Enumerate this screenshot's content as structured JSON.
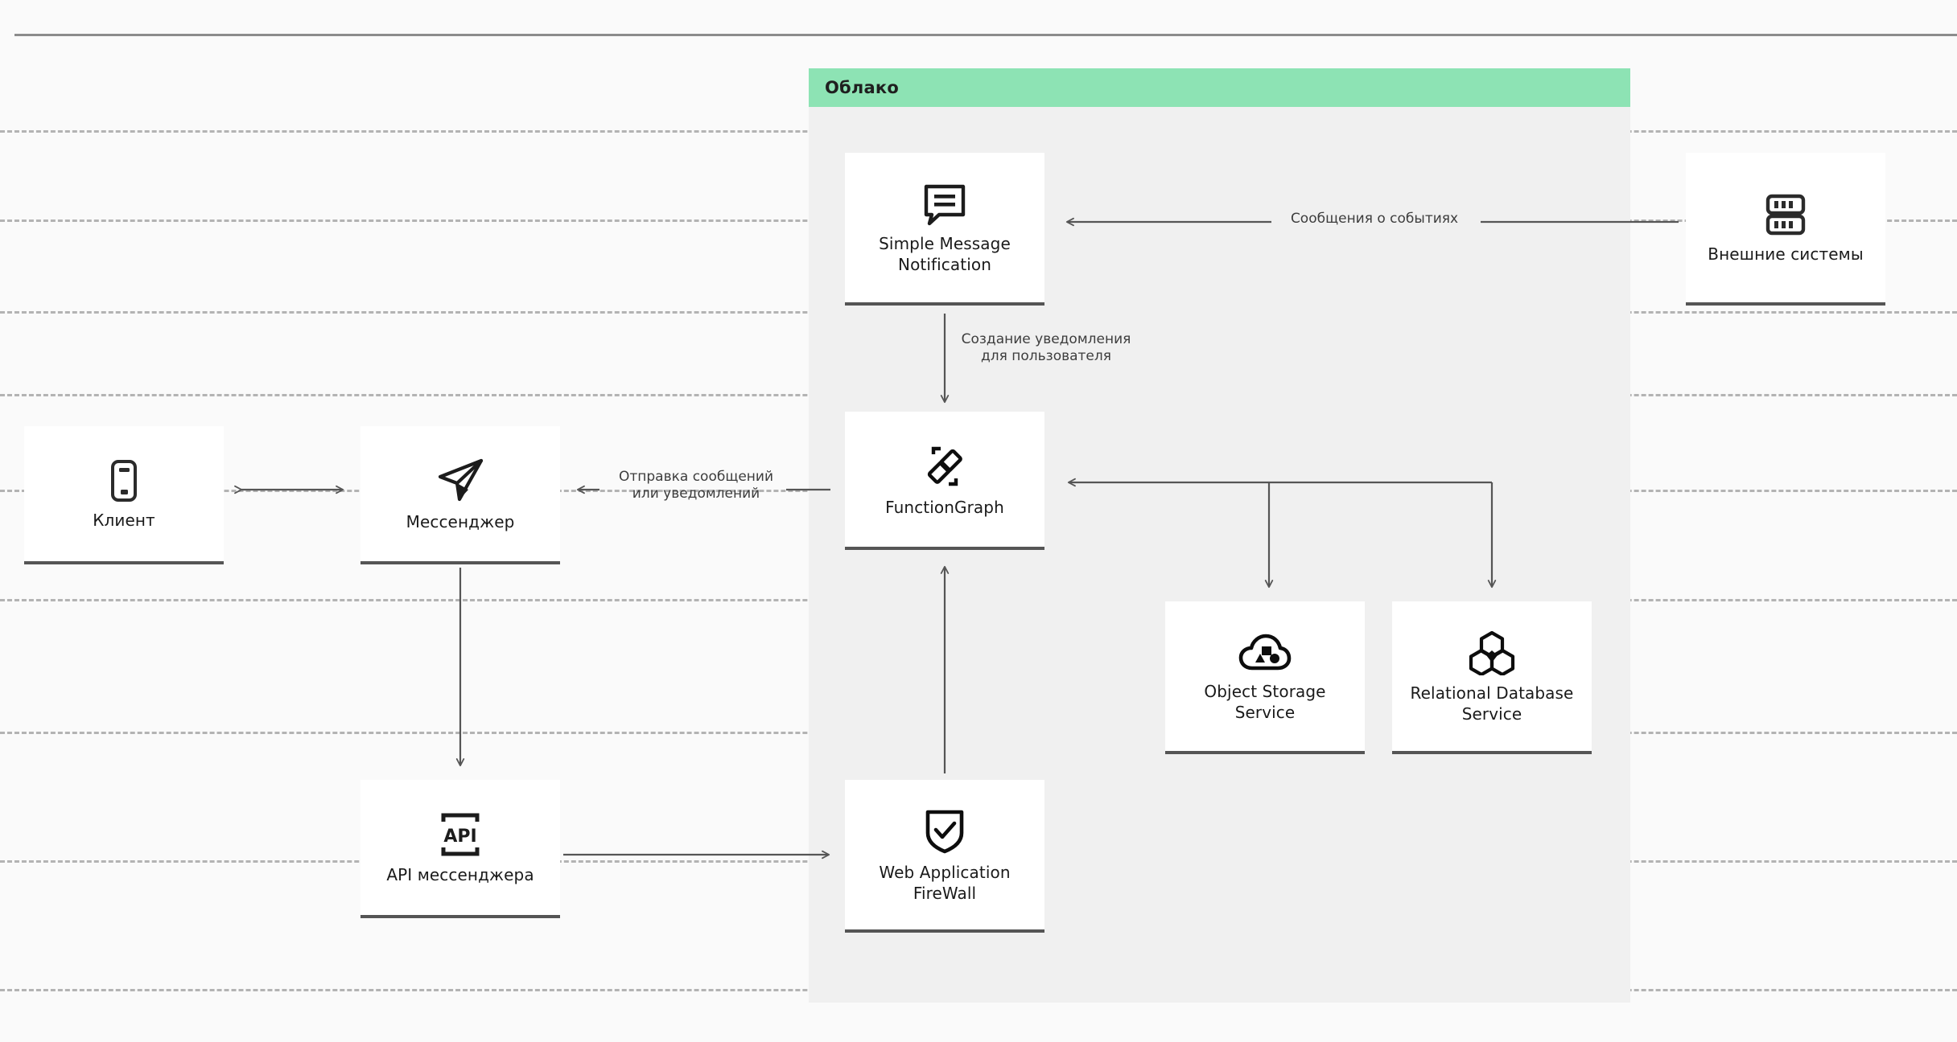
{
  "cloud": {
    "title": "Облако"
  },
  "nodes": {
    "client": {
      "label": "Клиент",
      "icon": "smartphone-icon"
    },
    "messenger": {
      "label": "Мессенджер",
      "icon": "paper-plane-icon"
    },
    "api": {
      "label": "API мессенджера",
      "icon": "api-brackets-icon"
    },
    "smn": {
      "label": "Simple Message\nNotification",
      "icon": "speech-bubble-icon"
    },
    "fg": {
      "label": "FunctionGraph",
      "icon": "chain-link-icon"
    },
    "waf": {
      "label": "Web Application\nFireWall",
      "icon": "shield-check-icon"
    },
    "oss": {
      "label": "Object Storage\nService",
      "icon": "cloud-objects-icon"
    },
    "rds": {
      "label": "Relational\nDatabase Service",
      "icon": "hexagons-icon"
    },
    "external": {
      "label": "Внешние системы",
      "icon": "server-rack-icon"
    }
  },
  "edges": {
    "events": {
      "label": "Сообщения о событиях"
    },
    "create": {
      "label": "Создание уведомления\nдля пользователя"
    },
    "send": {
      "label": "Отправка сообщений\nили уведомлений"
    }
  },
  "colors": {
    "cloud_header": "#8de3b4",
    "cloud_body": "#f0f0f0",
    "page_background": "#fafafa",
    "card_background": "#ffffff",
    "card_underline": "#555555",
    "connector": "#555555",
    "guide_dashed": "#b3b3b3",
    "guide_solid": "#8c8c8c",
    "text": "#1a1a1a"
  },
  "guides": {
    "solid_y": [
      42
    ],
    "dashed_y": [
      162,
      273,
      387,
      490,
      609,
      745,
      910,
      1070,
      1230
    ]
  }
}
